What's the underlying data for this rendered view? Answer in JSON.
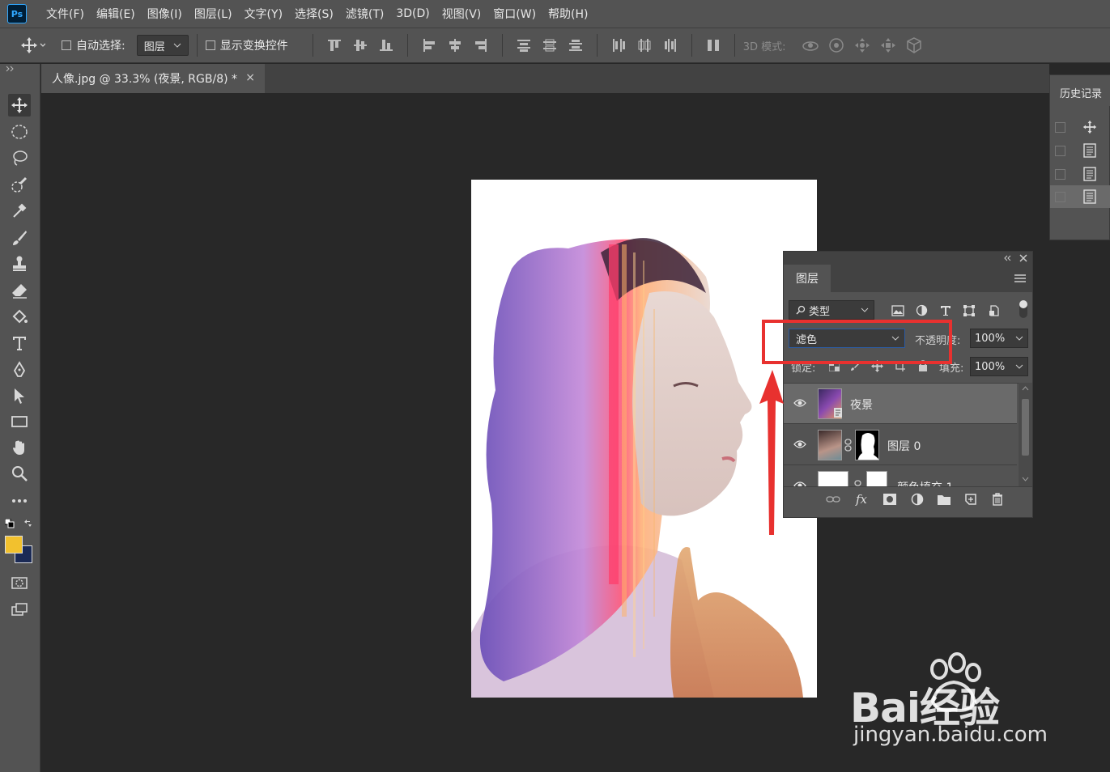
{
  "app": {
    "logo_text": "Ps"
  },
  "menu": [
    "文件(F)",
    "编辑(E)",
    "图像(I)",
    "图层(L)",
    "文字(Y)",
    "选择(S)",
    "滤镜(T)",
    "3D(D)",
    "视图(V)",
    "窗口(W)",
    "帮助(H)"
  ],
  "options_bar": {
    "auto_select_label": "自动选择:",
    "auto_select_target": "图层",
    "show_transform_label": "显示变换控件",
    "mode_3d_label": "3D 模式:"
  },
  "document_tab": {
    "title": "人像.jpg @ 33.3% (夜景, RGB/8) *",
    "close": "×"
  },
  "layers_panel": {
    "tab_label": "图层",
    "filter_kind": "类型",
    "blend_mode": "滤色",
    "opacity_label": "不透明度:",
    "opacity_value": "100%",
    "lock_label": "锁定:",
    "fill_label": "填充:",
    "fill_value": "100%",
    "layers": [
      {
        "name": "夜景",
        "selected": true
      },
      {
        "name": "图层 0",
        "selected": false
      },
      {
        "name": "颜色填充 1",
        "selected": false
      }
    ],
    "fx_label": "fx"
  },
  "history_panel": {
    "tab_label": "历史记录"
  },
  "watermark": {
    "brand": "Bai经验",
    "url": "jingyan.baidu.com"
  },
  "colors": {
    "foreground": "#f2c12e",
    "background": "#1b2a55",
    "annotation": "#e8312f",
    "selected_layer": "#6a6a6a"
  }
}
